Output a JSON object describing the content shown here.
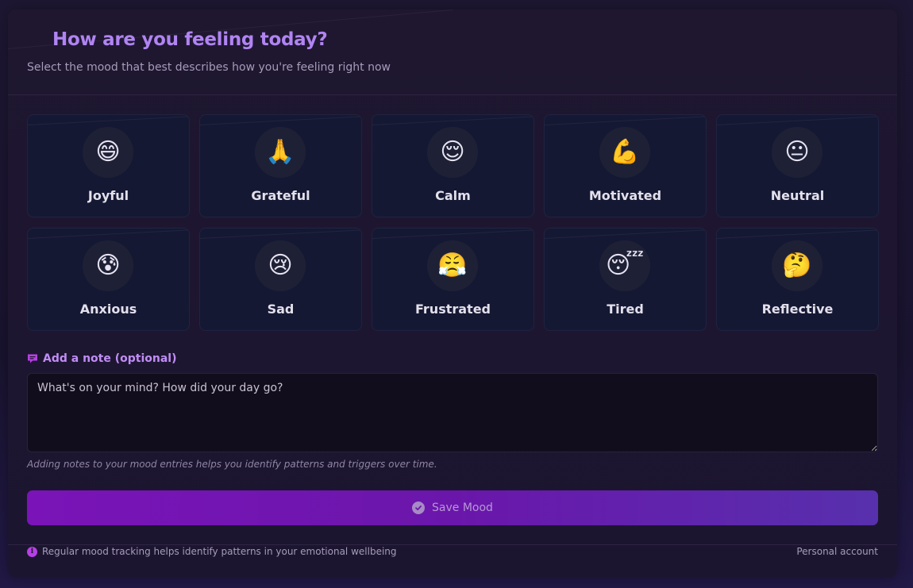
{
  "header": {
    "title": "How are you feeling today?",
    "subtitle": "Select the mood that best describes how you're feeling right now"
  },
  "moods": [
    {
      "label": "Joyful",
      "emoji": "😄",
      "icon": "grinning-face-icon"
    },
    {
      "label": "Grateful",
      "emoji": "🙏",
      "icon": "folded-hands-icon"
    },
    {
      "label": "Calm",
      "emoji": "😌",
      "icon": "relieved-face-icon"
    },
    {
      "label": "Motivated",
      "emoji": "💪",
      "icon": "flexed-biceps-icon"
    },
    {
      "label": "Neutral",
      "emoji": "😐",
      "icon": "neutral-face-icon"
    },
    {
      "label": "Anxious",
      "emoji": "😰",
      "icon": "anxious-face-icon"
    },
    {
      "label": "Sad",
      "emoji": "😢",
      "icon": "crying-face-icon"
    },
    {
      "label": "Frustrated",
      "emoji": "😤",
      "icon": "steam-nose-face-icon"
    },
    {
      "label": "Tired",
      "emoji": "😴",
      "icon": "sleeping-face-icon"
    },
    {
      "label": "Reflective",
      "emoji": "🤔",
      "icon": "thinking-face-icon"
    }
  ],
  "note": {
    "label": "Add a note (optional)",
    "placeholder": "What's on your mind? How did your day go?",
    "hint": "Adding notes to your mood entries helps you identify patterns and triggers over time."
  },
  "save": {
    "label": "Save Mood"
  },
  "footer": {
    "info": "Regular mood tracking helps identify patterns in your emotional wellbeing",
    "account": "Personal account"
  },
  "colors": {
    "accent": "#b084f2",
    "button_start": "#7a14b8",
    "button_end": "#5730ad",
    "card_bg": "#151833"
  }
}
